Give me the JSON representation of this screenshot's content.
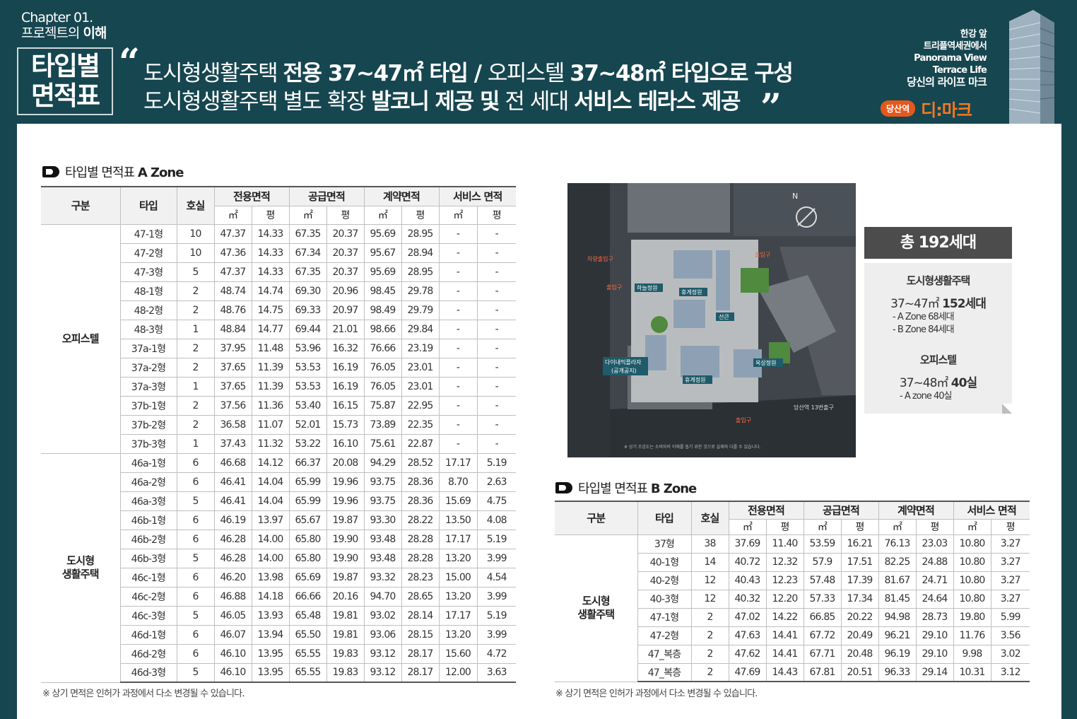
{
  "header": {
    "chapter": "Chapter 01.",
    "chapter_sub_prefix": "프로젝트의 ",
    "chapter_sub_bold": "이해",
    "title_line1": "타입별",
    "title_line2": "면적표",
    "quote_open": "“",
    "quote_close": "”",
    "line1": [
      {
        "text": "도시형생활주택 ",
        "bold": false
      },
      {
        "text": "전용 37~47㎡ 타입",
        "bold": true
      },
      {
        "text": " / ",
        "bold": true
      },
      {
        "text": "오피스텔 ",
        "bold": false
      },
      {
        "text": "37~48㎡ 타입으로 구성",
        "bold": true
      }
    ],
    "line2": [
      {
        "text": "도시형생활주택 별도 확장 ",
        "bold": false
      },
      {
        "text": "발코니 제공 및",
        "bold": true
      },
      {
        "text": " 전 세대 ",
        "bold": false
      },
      {
        "text": "서비스 테라스 제공",
        "bold": true
      }
    ]
  },
  "promo": {
    "line1": "한강 앞",
    "line2": "트리플역세권에서",
    "line3": "Panorama View",
    "line4": "Terrace Life",
    "line5": "당신의 라이프 마크",
    "badge": "당산역",
    "brand": "디:마크"
  },
  "zone_a": {
    "title_prefix": "타입별 면적표 ",
    "title_bold": "A Zone",
    "headers": {
      "group": "구분",
      "type": "타입",
      "units": "호실",
      "exclusive": "전용면적",
      "supply": "공급면적",
      "contract": "계약면적",
      "service": "서비스 면적",
      "m2": "㎡",
      "pyeong": "평"
    },
    "group1": "오피스텔",
    "group2_l1": "도시형",
    "group2_l2": "생활주택",
    "rows": [
      [
        "47-1형",
        "10",
        "47.37",
        "14.33",
        "67.35",
        "20.37",
        "95.69",
        "28.95",
        "-",
        "-"
      ],
      [
        "47-2형",
        "10",
        "47.36",
        "14.33",
        "67.34",
        "20.37",
        "95.67",
        "28.94",
        "-",
        "-"
      ],
      [
        "47-3형",
        "5",
        "47.37",
        "14.33",
        "67.35",
        "20.37",
        "95.69",
        "28.95",
        "-",
        "-"
      ],
      [
        "48-1형",
        "2",
        "48.74",
        "14.74",
        "69.30",
        "20.96",
        "98.45",
        "29.78",
        "-",
        "-"
      ],
      [
        "48-2형",
        "2",
        "48.76",
        "14.75",
        "69.33",
        "20.97",
        "98.49",
        "29.79",
        "-",
        "-"
      ],
      [
        "48-3형",
        "1",
        "48.84",
        "14.77",
        "69.44",
        "21.01",
        "98.66",
        "29.84",
        "-",
        "-"
      ],
      [
        "37a-1형",
        "2",
        "37.95",
        "11.48",
        "53.96",
        "16.32",
        "76.66",
        "23.19",
        "-",
        "-"
      ],
      [
        "37a-2형",
        "2",
        "37.65",
        "11.39",
        "53.53",
        "16.19",
        "76.05",
        "23.01",
        "-",
        "-"
      ],
      [
        "37a-3형",
        "1",
        "37.65",
        "11.39",
        "53.53",
        "16.19",
        "76.05",
        "23.01",
        "-",
        "-"
      ],
      [
        "37b-1형",
        "2",
        "37.56",
        "11.36",
        "53.40",
        "16.15",
        "75.87",
        "22.95",
        "-",
        "-"
      ],
      [
        "37b-2형",
        "2",
        "36.58",
        "11.07",
        "52.01",
        "15.73",
        "73.89",
        "22.35",
        "-",
        "-"
      ],
      [
        "37b-3형",
        "1",
        "37.43",
        "11.32",
        "53.22",
        "16.10",
        "75.61",
        "22.87",
        "-",
        "-"
      ],
      [
        "46a-1형",
        "6",
        "46.68",
        "14.12",
        "66.37",
        "20.08",
        "94.29",
        "28.52",
        "17.17",
        "5.19"
      ],
      [
        "46a-2형",
        "6",
        "46.41",
        "14.04",
        "65.99",
        "19.96",
        "93.75",
        "28.36",
        "8.70",
        "2.63"
      ],
      [
        "46a-3형",
        "5",
        "46.41",
        "14.04",
        "65.99",
        "19.96",
        "93.75",
        "28.36",
        "15.69",
        "4.75"
      ],
      [
        "46b-1형",
        "6",
        "46.19",
        "13.97",
        "65.67",
        "19.87",
        "93.30",
        "28.22",
        "13.50",
        "4.08"
      ],
      [
        "46b-2형",
        "6",
        "46.28",
        "14.00",
        "65.80",
        "19.90",
        "93.48",
        "28.28",
        "17.17",
        "5.19"
      ],
      [
        "46b-3형",
        "5",
        "46.28",
        "14.00",
        "65.80",
        "19.90",
        "93.48",
        "28.28",
        "13.20",
        "3.99"
      ],
      [
        "46c-1형",
        "6",
        "46.20",
        "13.98",
        "65.69",
        "19.87",
        "93.32",
        "28.23",
        "15.00",
        "4.54"
      ],
      [
        "46c-2형",
        "6",
        "46.88",
        "14.18",
        "66.66",
        "20.16",
        "94.70",
        "28.65",
        "13.20",
        "3.99"
      ],
      [
        "46c-3형",
        "5",
        "46.05",
        "13.93",
        "65.48",
        "19.81",
        "93.02",
        "28.14",
        "17.17",
        "5.19"
      ],
      [
        "46d-1형",
        "6",
        "46.07",
        "13.94",
        "65.50",
        "19.81",
        "93.06",
        "28.15",
        "13.20",
        "3.99"
      ],
      [
        "46d-2형",
        "6",
        "46.10",
        "13.95",
        "65.55",
        "19.83",
        "93.12",
        "28.17",
        "15.60",
        "4.72"
      ],
      [
        "46d-3형",
        "5",
        "46.10",
        "13.95",
        "65.55",
        "19.83",
        "93.12",
        "28.17",
        "12.00",
        "3.63"
      ]
    ],
    "note": "※ 상기 면적은 인허가 과정에서 다소 변경될 수 있습니다."
  },
  "zone_b": {
    "title_prefix": "타입별 면적표 ",
    "title_bold": "B Zone",
    "group_l1": "도시형",
    "group_l2": "생활주택",
    "rows": [
      [
        "37형",
        "38",
        "37.69",
        "11.40",
        "53.59",
        "16.21",
        "76.13",
        "23.03",
        "10.80",
        "3.27"
      ],
      [
        "40-1형",
        "14",
        "40.72",
        "12.32",
        "57.9",
        "17.51",
        "82.25",
        "24.88",
        "10.80",
        "3.27"
      ],
      [
        "40-2형",
        "12",
        "40.43",
        "12.23",
        "57.48",
        "17.39",
        "81.67",
        "24.71",
        "10.80",
        "3.27"
      ],
      [
        "40-3형",
        "12",
        "40.32",
        "12.20",
        "57.33",
        "17.34",
        "81.45",
        "24.64",
        "10.80",
        "3.27"
      ],
      [
        "47-1형",
        "2",
        "47.02",
        "14.22",
        "66.85",
        "20.22",
        "94.98",
        "28.73",
        "19.80",
        "5.99"
      ],
      [
        "47-2형",
        "2",
        "47.63",
        "14.41",
        "67.72",
        "20.49",
        "96.21",
        "29.10",
        "11.76",
        "3.56"
      ],
      [
        "47_복층",
        "2",
        "47.62",
        "14.41",
        "67.71",
        "20.48",
        "96.19",
        "29.10",
        "9.98",
        "3.02"
      ],
      [
        "47_복층",
        "2",
        "47.69",
        "14.43",
        "67.81",
        "20.51",
        "96.33",
        "29.14",
        "10.31",
        "3.12"
      ]
    ],
    "note": "※ 상기 면적은 인허가 과정에서 다소 변경될 수 있습니다."
  },
  "siteplan": {
    "labels": {
      "vehicle": "차량출입구",
      "entrance1": "출입구",
      "entrance2": "출입구",
      "entrance3": "출입구",
      "sky_garden": "하늘정원",
      "rest_garden1": "휴게정원",
      "rest_garden2": "휴게정원",
      "pilotis": "선큰",
      "rooftop_garden": "옥상정원",
      "dynamic_plaza": "다이내믹플라자",
      "public_space": "(공개공지)",
      "station_exit": "당산역 13번출구",
      "note": "※ 상기 조감도는 소비자의 이해를 돕기 위한 것으로 실제와 다를 수 있습니다."
    },
    "compass": "N"
  },
  "summary": {
    "title": "총 192세대",
    "cat1": "도시형생활주택",
    "cat1_range": "37~47㎡ ",
    "cat1_count": "152세대",
    "cat1_a": "- A Zone 68세대",
    "cat1_b": "- B Zone 84세대",
    "cat2": "오피스텔",
    "cat2_range": "37~48㎡ ",
    "cat2_count": "40실",
    "cat2_a": "- A zone 40실"
  },
  "colors": {
    "header_bg": "#164650",
    "accent_orange": "#f47a20",
    "badge_orange": "#e5581c",
    "summary_head": "#4c4c4c",
    "summary_bg": "#eeeeee"
  }
}
